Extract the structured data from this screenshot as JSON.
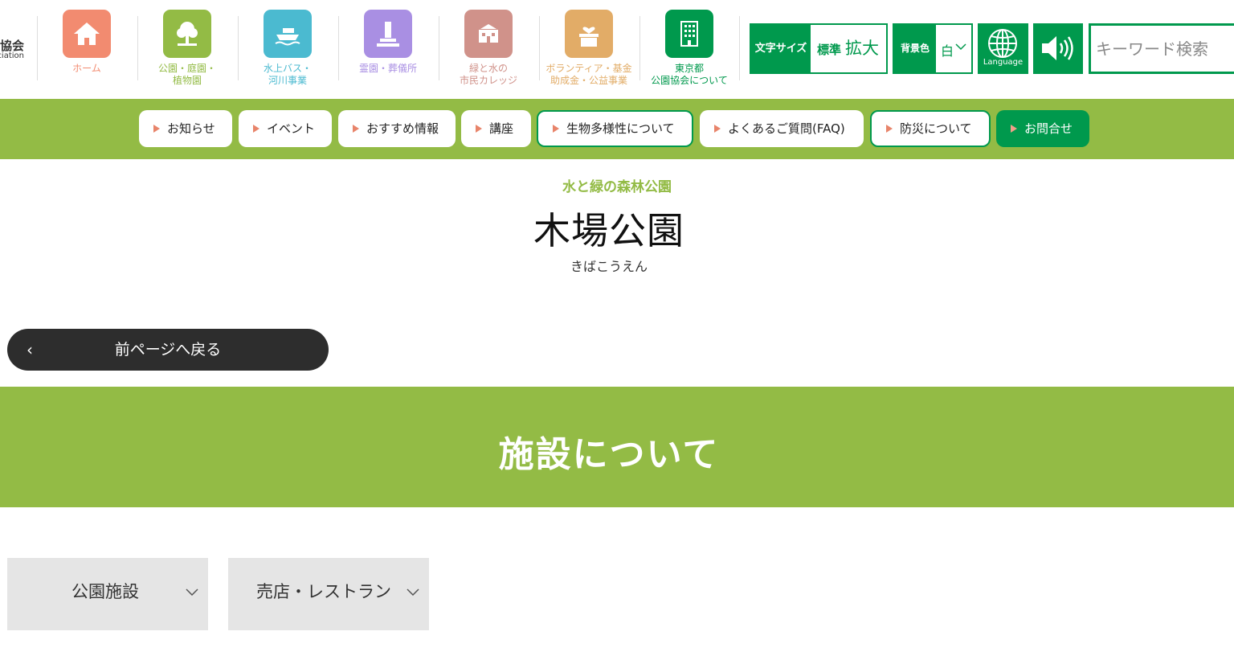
{
  "logo": {
    "line1": "協会",
    "line2": "ciation"
  },
  "nav": [
    {
      "label": "ホーム",
      "color": "#f28b70",
      "icon": "home-icon"
    },
    {
      "label": "公園・庭園・\n植物園",
      "color": "#93bb45",
      "icon": "tree-icon"
    },
    {
      "label": "水上バス・\n河川事業",
      "color": "#4bbad0",
      "icon": "boat-icon"
    },
    {
      "label": "霊園・葬儀所",
      "color": "#a98fe3",
      "icon": "gravestone-icon"
    },
    {
      "label": "緑と水の\n市民カレッジ",
      "color": "#d0928a",
      "icon": "school-icon"
    },
    {
      "label": "ボランティア・基金\n助成金・公益事業",
      "color": "#e2ac67",
      "icon": "donation-box-icon"
    },
    {
      "label": "東京都\n公園協会について",
      "color": "#00994d",
      "icon": "building-icon"
    }
  ],
  "utilities": {
    "font_size_label": "文字サイズ",
    "font_size_standard": "標準",
    "font_size_large": "拡大",
    "bg_color_label": "背景色",
    "bg_color_value": "白",
    "language_label": "Language",
    "search_placeholder": "キーワード検索"
  },
  "subnav": [
    {
      "label": "お知らせ",
      "style": "plain"
    },
    {
      "label": "イベント",
      "style": "plain"
    },
    {
      "label": "おすすめ情報",
      "style": "plain"
    },
    {
      "label": "講座",
      "style": "plain"
    },
    {
      "label": "生物多様性について",
      "style": "outlined"
    },
    {
      "label": "よくあるご質問(FAQ)",
      "style": "plain"
    },
    {
      "label": "防災について",
      "style": "outlined"
    },
    {
      "label": "お問合せ",
      "style": "dark"
    }
  ],
  "page": {
    "subtitle": "水と緑の森林公園",
    "title": "木場公園",
    "ruby": "きばこうえん",
    "back_button": "前ページへ戻る",
    "section_title": "施設について"
  },
  "tabs": [
    {
      "label": "公園施設"
    },
    {
      "label": "売店・レストラン"
    }
  ],
  "colors": {
    "accent_green": "#00994d",
    "section_green": "#93bb45",
    "tab_bg": "#e5e5e5"
  }
}
